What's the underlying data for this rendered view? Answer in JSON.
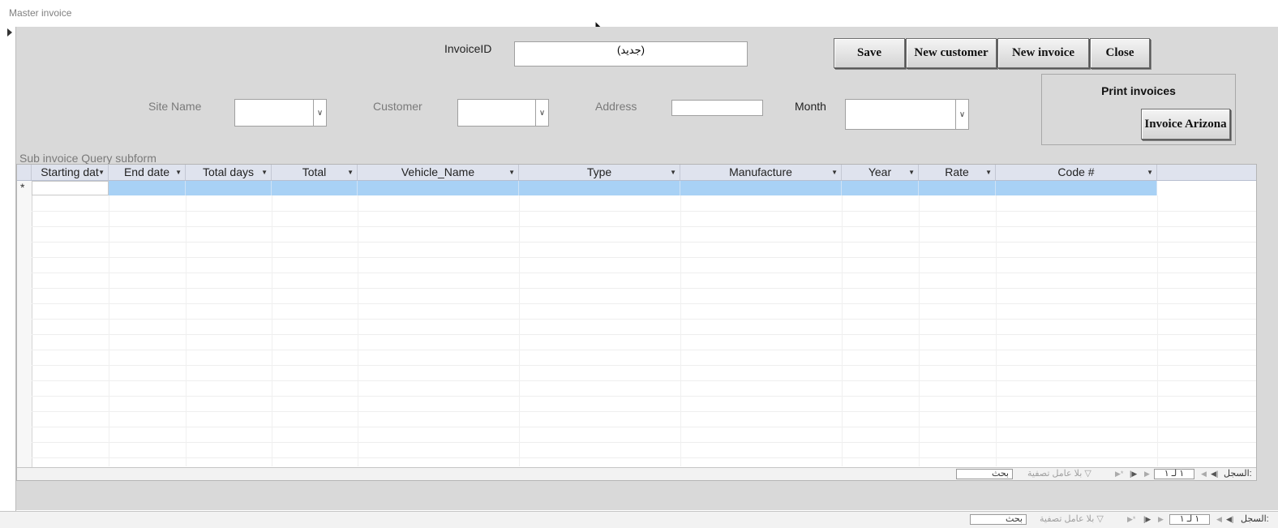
{
  "window": {
    "title": "Master invoice"
  },
  "form": {
    "invoice_id_label": "InvoiceID",
    "invoice_id_value": "(جديد)",
    "site_name_label": "Site Name",
    "customer_label": "Customer",
    "address_label": "Address",
    "month_label": "Month",
    "buttons": {
      "save": "Save",
      "new_customer": "New customer",
      "new_invoice": "New invoice",
      "close": "Close"
    },
    "print_group": {
      "title": "Print invoices",
      "invoice_arizona": "Invoice Arizona"
    }
  },
  "subform": {
    "label": "Sub invoice Query subform",
    "columns": [
      "Starting dat",
      "End date",
      "Total days",
      "Total",
      "Vehicle_Name",
      "Type",
      "Manufacture",
      "Year",
      "Rate",
      "Code #"
    ],
    "new_record_marker": "*"
  },
  "subform_nav": {
    "record_label": "السجل:",
    "position": "١ لـ ١",
    "filter_text": "بلا عامل تصفية",
    "search_placeholder": "بحث"
  },
  "form_nav": {
    "record_label": "السجل:",
    "position": "١ لـ ١",
    "filter_text": "بلا عامل تصفية",
    "search_placeholder": "بحث"
  }
}
